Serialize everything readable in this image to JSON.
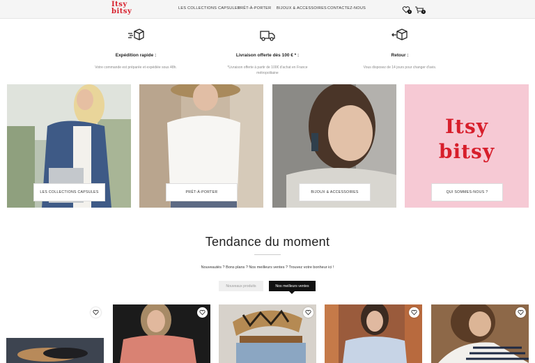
{
  "header": {
    "logo": "Itsy bitsy",
    "nav": [
      "LES COLLECTIONS CAPSULES",
      "PRÊT-À-PORTER",
      "BIJOUX & ACCESSOIRES",
      "CONTACTEZ-NOUS"
    ],
    "wishlist_count": "0",
    "cart_count": "0"
  },
  "features": [
    {
      "icon": "box-fast-icon",
      "title": "Expédition rapide :",
      "desc": "Votre commande est préparée et expédiée sous 48h."
    },
    {
      "icon": "delivery-truck-icon",
      "title": "Livraison offerte dès 100 € * :",
      "desc": "*Livraison offerte à partir de 100€ d'achat en France métropolitaine"
    },
    {
      "icon": "box-return-icon",
      "title": "Retour :",
      "desc": "Vous disposez de 14 jours pour changer d'avis."
    }
  ],
  "categories": [
    "LES COLLECTIONS CAPSULES",
    "PRÊT-À-PORTER",
    "BIJOUX & ACCESSOIRES",
    "QUI SOMMES-NOUS ?"
  ],
  "brand_tile": {
    "line1": "Itsy",
    "line2": "bitsy"
  },
  "trending": {
    "title": "Tendance du moment",
    "subtitle": "Nouveautés ? Bons plans ? Nos meilleurs ventes ? Trouvez votre bonheur ici !",
    "tabs": [
      "Nouveaux produits",
      "Nos meilleurs ventes"
    ]
  },
  "colors": {
    "brand_red": "#d71e2b",
    "pink_tile": "#f6c9d4",
    "tab_active": "#111111"
  }
}
